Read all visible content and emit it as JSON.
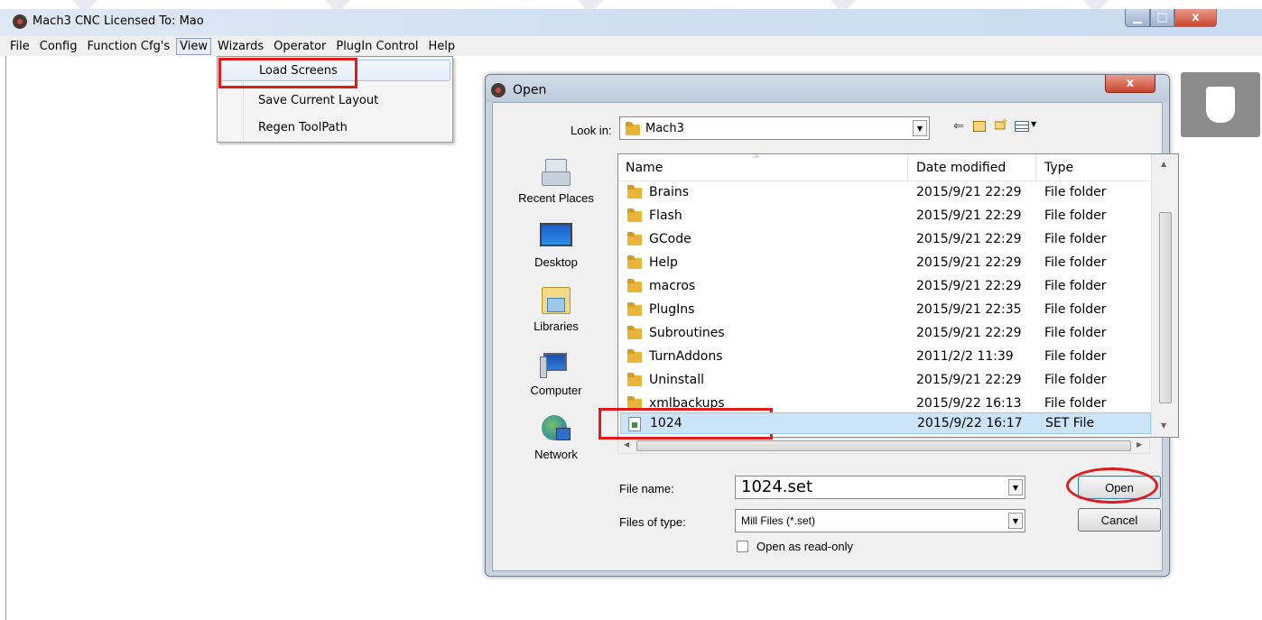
{
  "window": {
    "title": "Mach3 CNC  Licensed To: Mao",
    "min_glyph": "▁",
    "max_glyph": "□",
    "close_glyph": "x"
  },
  "menubar": [
    "File",
    "Config",
    "Function Cfg's",
    "View",
    "Wizards",
    "Operator",
    "PlugIn Control",
    "Help"
  ],
  "view_menu": {
    "items": [
      "Load Screens",
      "Save Current Layout",
      "Regen ToolPath"
    ],
    "highlighted": "Load Screens"
  },
  "dialog": {
    "title": "Open",
    "close_glyph": "x",
    "look_in_label": "Look in:",
    "look_in_value": "Mach3",
    "places": [
      "Recent Places",
      "Desktop",
      "Libraries",
      "Computer",
      "Network"
    ],
    "columns": [
      "Name",
      "Date modified",
      "Type"
    ],
    "rows": [
      {
        "name": "Brains",
        "date": "2015/9/21 22:29",
        "type": "File folder",
        "kind": "folder"
      },
      {
        "name": "Flash",
        "date": "2015/9/21 22:29",
        "type": "File folder",
        "kind": "folder"
      },
      {
        "name": "GCode",
        "date": "2015/9/21 22:29",
        "type": "File folder",
        "kind": "folder"
      },
      {
        "name": "Help",
        "date": "2015/9/21 22:29",
        "type": "File folder",
        "kind": "folder"
      },
      {
        "name": "macros",
        "date": "2015/9/21 22:29",
        "type": "File folder",
        "kind": "folder"
      },
      {
        "name": "PlugIns",
        "date": "2015/9/21 22:35",
        "type": "File folder",
        "kind": "folder"
      },
      {
        "name": "Subroutines",
        "date": "2015/9/21 22:29",
        "type": "File folder",
        "kind": "folder"
      },
      {
        "name": "TurnAddons",
        "date": "2011/2/2 11:39",
        "type": "File folder",
        "kind": "folder"
      },
      {
        "name": "Uninstall",
        "date": "2015/9/21 22:29",
        "type": "File folder",
        "kind": "folder"
      },
      {
        "name": "xmlbackups",
        "date": "2015/9/22 16:13",
        "type": "File folder",
        "kind": "folder"
      },
      {
        "name": "1024",
        "date": "2015/9/22 16:17",
        "type": "SET File",
        "kind": "set"
      }
    ],
    "selected_row": "1024",
    "file_name_label": "File name:",
    "file_name_value": "1024.set",
    "files_of_type_label": "Files of type:",
    "files_of_type_value": "Mill Files (*.set)",
    "read_only_label": "Open as read-only",
    "read_only_checked": false,
    "open_button": "Open",
    "cancel_button": "Cancel"
  },
  "colors": {
    "annotation_red": "#e01b1b",
    "selection": "#cce4f7",
    "folder": "#e8b53a"
  }
}
